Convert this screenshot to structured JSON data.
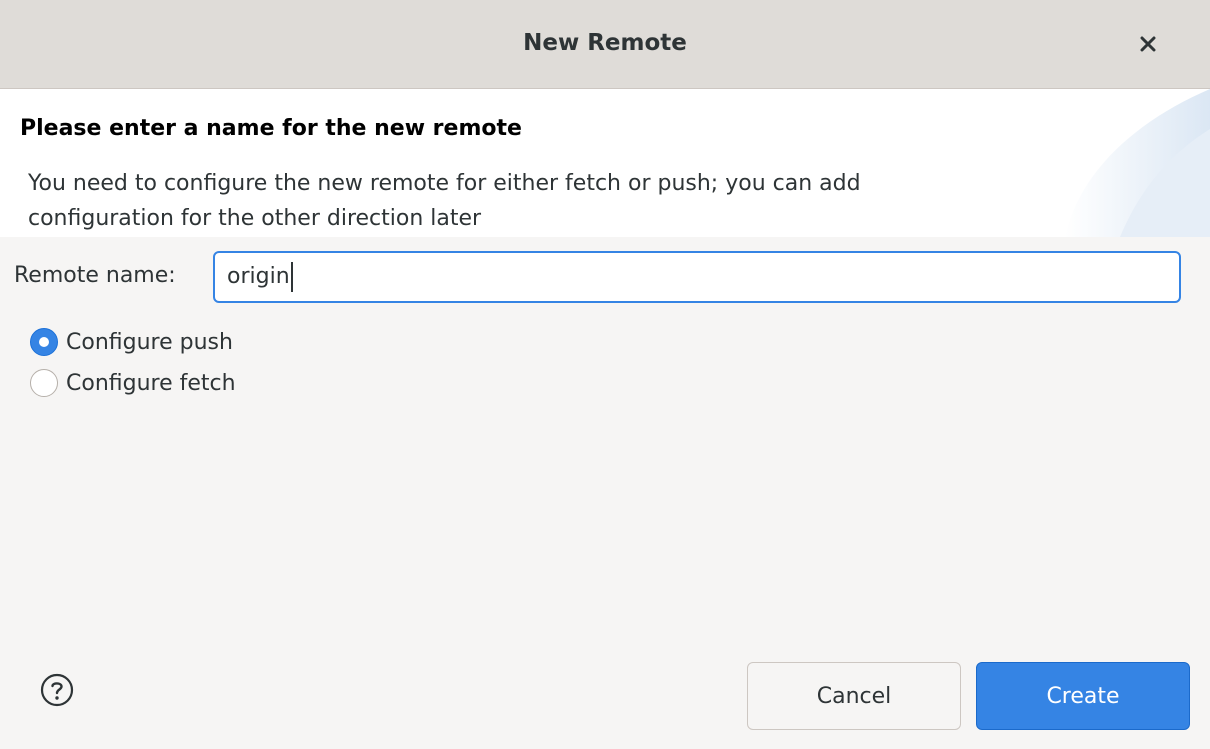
{
  "window": {
    "title": "New Remote",
    "close_icon": "close-icon"
  },
  "banner": {
    "heading": "Please enter a name for the new remote",
    "description_line1": "You need to configure the new remote for either fetch or push; you can add",
    "description_line2": "configuration for the other direction later"
  },
  "form": {
    "remote_name_label": "Remote name:",
    "remote_name_value": "origin",
    "options": [
      {
        "label": "Configure push",
        "checked": true
      },
      {
        "label": "Configure fetch",
        "checked": false
      }
    ]
  },
  "footer": {
    "help_icon": "help-icon",
    "cancel_label": "Cancel",
    "create_label": "Create"
  },
  "colors": {
    "accent": "#3584e4",
    "titlebar_bg": "#dfdcd8",
    "dialog_bg": "#f6f5f4",
    "banner_bg": "#ffffff"
  }
}
